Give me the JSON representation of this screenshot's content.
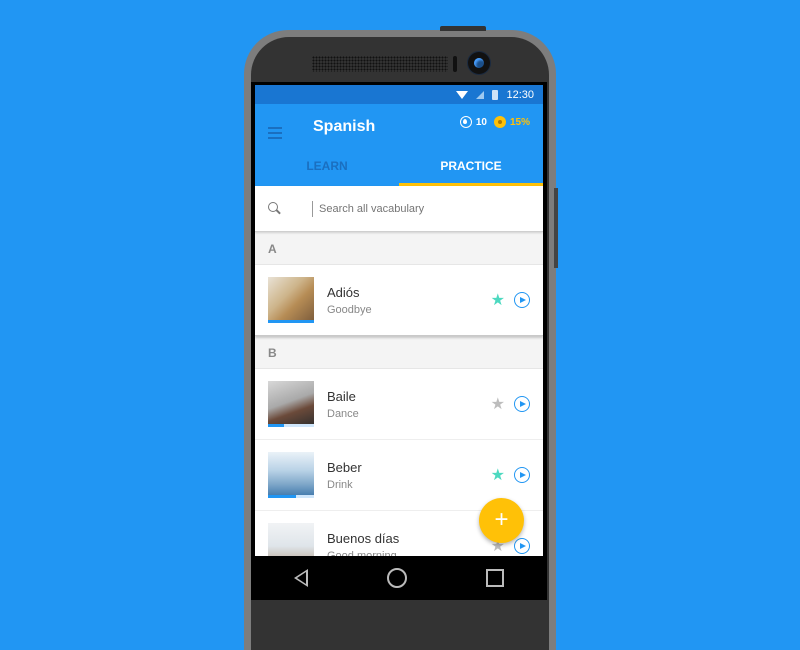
{
  "status_bar": {
    "time": "12:30",
    "icons": [
      "wifi-icon",
      "signal-icon",
      "battery-icon"
    ]
  },
  "app_bar": {
    "title": "Spanish",
    "streak_count": "10",
    "progress_percent": "15%",
    "tabs": [
      {
        "label": "LEARN",
        "active": false
      },
      {
        "label": "PRACTICE",
        "active": true
      }
    ]
  },
  "search": {
    "placeholder": "Search all vacabulary",
    "value": ""
  },
  "colors": {
    "primary": "#2196F3",
    "primary_dark": "#1976D2",
    "accent": "#FFC107",
    "star_on": "#4DD9C0",
    "star_off": "#BDBDBD"
  },
  "sections": [
    {
      "letter": "A",
      "items": [
        {
          "word": "Adiós",
          "translation": "Goodbye",
          "starred": true,
          "progress": 1.0
        }
      ]
    },
    {
      "letter": "B",
      "items": [
        {
          "word": "Baile",
          "translation": "Dance",
          "starred": false,
          "progress": 0.35
        },
        {
          "word": "Beber",
          "translation": "Drink",
          "starred": true,
          "progress": 0.6
        },
        {
          "word": "Buenos días",
          "translation": "Good morning",
          "starred": false,
          "progress": 0.0
        }
      ]
    }
  ],
  "fab": {
    "label": "+"
  }
}
